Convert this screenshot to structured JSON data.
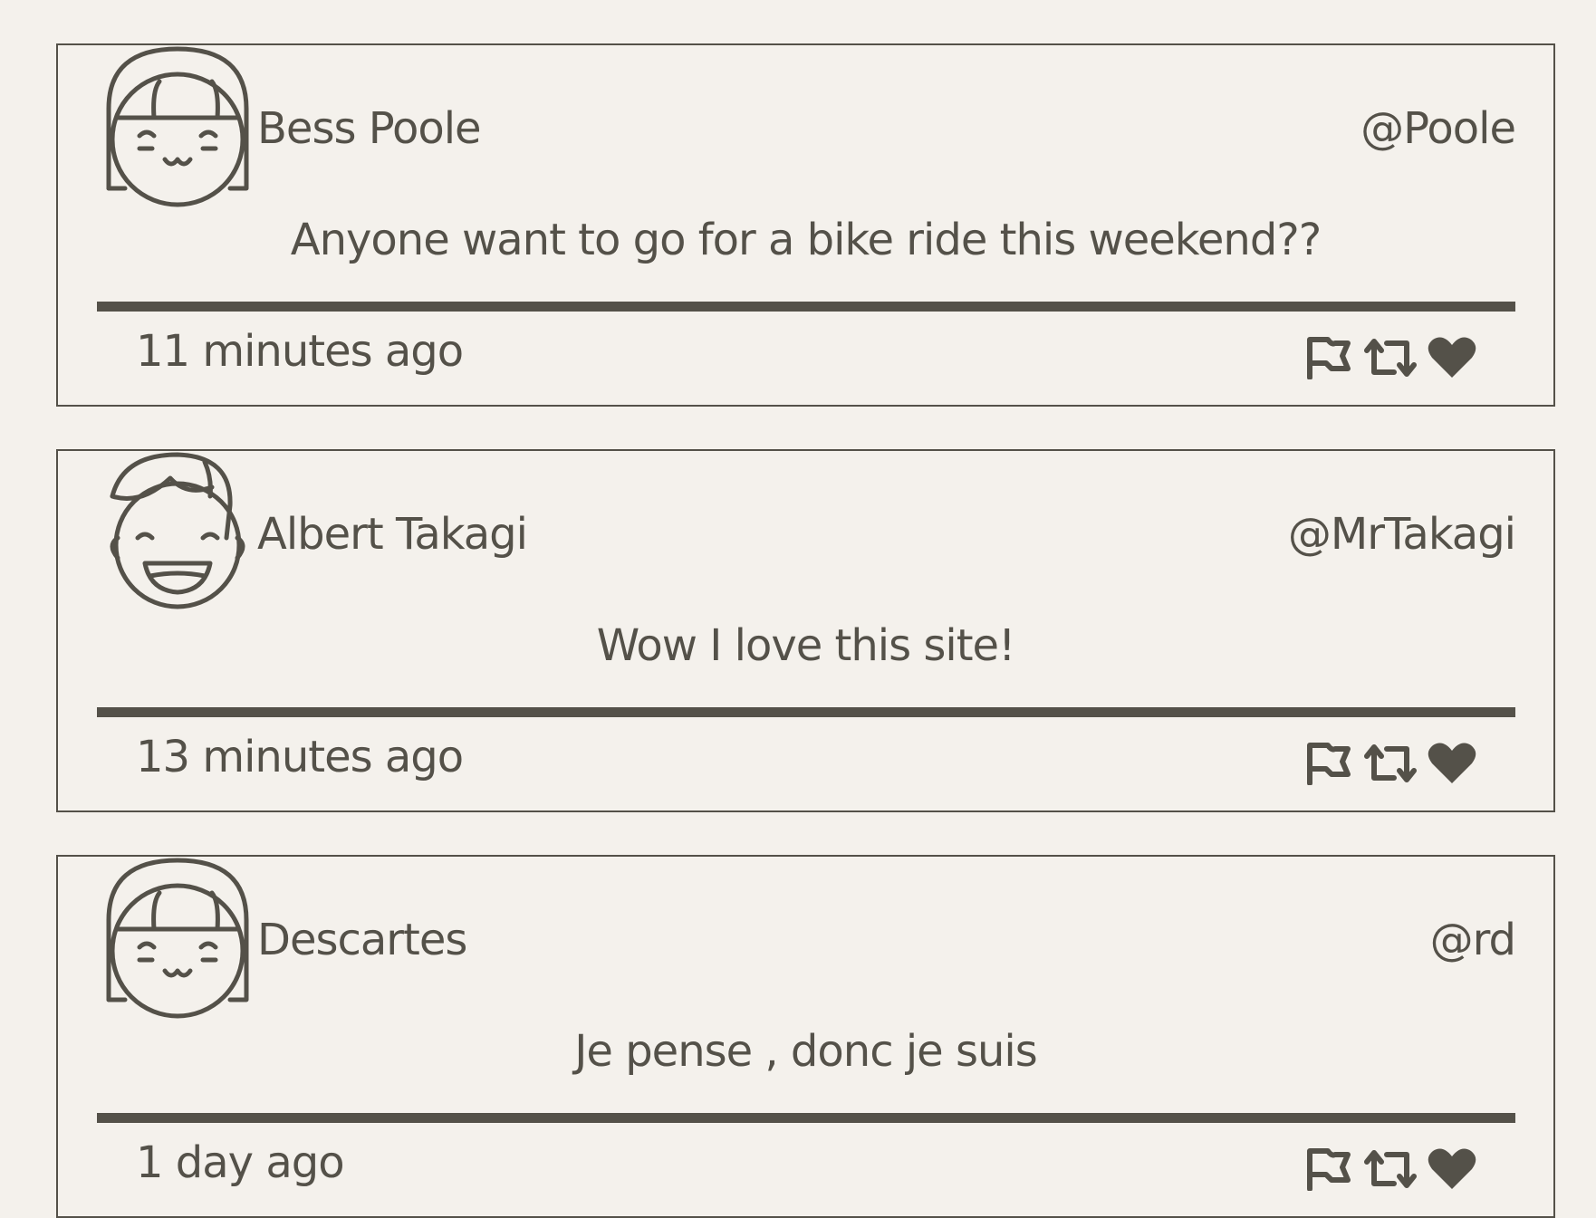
{
  "colors": {
    "background": "#f4f1ec",
    "ink": "#545149"
  },
  "posts": [
    {
      "name": "Bess Poole",
      "handle": "@Poole",
      "message": "Anyone want to go for a bike ride this weekend??",
      "time": "11 minutes ago",
      "avatar": "girl-avatar-icon"
    },
    {
      "name": "Albert Takagi",
      "handle": "@MrTakagi",
      "message": "Wow I love this site!",
      "time": "13 minutes ago",
      "avatar": "boy-avatar-icon"
    },
    {
      "name": "Descartes",
      "handle": "@rd",
      "message": "Je pense , donc je suis",
      "time": "1 day ago",
      "avatar": "girl-avatar-icon"
    }
  ],
  "actions": [
    "flag-icon",
    "retweet-icon",
    "heart-icon"
  ]
}
